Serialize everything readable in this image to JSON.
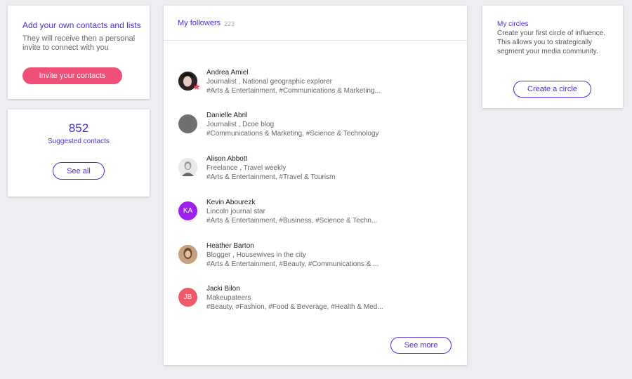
{
  "invite": {
    "title": "Add your own contacts and lists",
    "description": "They will receive then a personal invite to connect with you",
    "button": "Invite your contacts"
  },
  "suggested": {
    "count": "852",
    "label": "Suggested contacts",
    "button": "See all"
  },
  "followers": {
    "title": "My followers",
    "count": "223",
    "see_more": "See more",
    "items": [
      {
        "name": "Andrea Amiel",
        "subtitle": "Journalist , National geographic explorer",
        "tags": "#Arts & Entertainment, #Communications & Marketing...",
        "avatar": "photo"
      },
      {
        "name": "Danielle Abril",
        "subtitle": "Journalist , Dcoe blog",
        "tags": "#Communications & Marketing, #Science & Technology",
        "avatar": "gray"
      },
      {
        "name": "Alison Abbott",
        "subtitle": "Freelance , Travel weekly",
        "tags": "#Arts & Entertainment, #Travel & Tourism",
        "avatar": "photo"
      },
      {
        "name": "Kevin Abourezk",
        "subtitle": "Lincoln journal star",
        "tags": "#Arts & Entertainment, #Business, #Science & Techn...",
        "avatar": "KA",
        "color": "#a020f0"
      },
      {
        "name": "Heather Barton",
        "subtitle": "Blogger , Housewives in the city",
        "tags": "#Arts & Entertainment, #Beauty, #Communications & ...",
        "avatar": "photo"
      },
      {
        "name": "Jacki Bilon",
        "subtitle": "Makeupateers",
        "tags": "#Beauty, #Fashion, #Food & Beverage, #Health & Med...",
        "avatar": "JB",
        "color": "#ef5a6a"
      }
    ]
  },
  "circles": {
    "title": "My circles",
    "description": "Create your first circle of influence. This allows you to strategically segment your media community.",
    "button": "Create a circle"
  },
  "colors": {
    "accent": "#4a2ee0",
    "pink": "#f04f77",
    "background": "#edeef2"
  }
}
